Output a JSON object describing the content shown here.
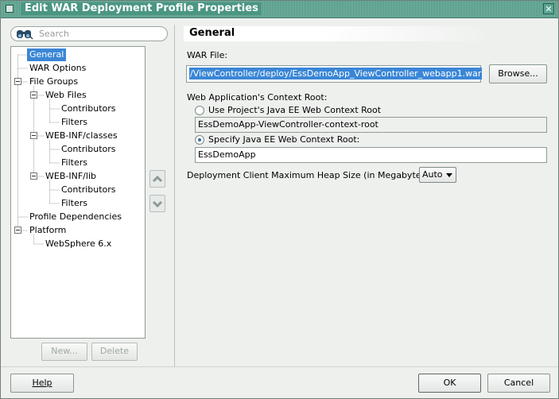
{
  "window": {
    "title": "Edit WAR Deployment Profile Properties"
  },
  "search": {
    "placeholder": "Search"
  },
  "tree": {
    "items": [
      {
        "label": "General",
        "selected": true
      },
      {
        "label": "WAR Options"
      },
      {
        "label": "File Groups"
      },
      {
        "label": "Web Files"
      },
      {
        "label": "Contributors"
      },
      {
        "label": "Filters"
      },
      {
        "label": "WEB-INF/classes"
      },
      {
        "label": "Contributors"
      },
      {
        "label": "Filters"
      },
      {
        "label": "WEB-INF/lib"
      },
      {
        "label": "Contributors"
      },
      {
        "label": "Filters"
      },
      {
        "label": "Profile Dependencies"
      },
      {
        "label": "Platform"
      },
      {
        "label": "WebSphere 6.x"
      }
    ]
  },
  "tree_buttons": {
    "new": "New...",
    "delete": "Delete"
  },
  "reorder": {
    "up_icon": "chevron-up-icon",
    "down_icon": "chevron-down-icon"
  },
  "panel": {
    "title": "General",
    "war_file_label": "WAR File:",
    "war_file_value": "/ViewController/deploy/EssDemoApp_ViewController_webapp1.war",
    "browse": "Browse...",
    "context_root_label": "Web Application's Context Root:",
    "option_project": "Use Project's Java EE Web Context Root",
    "project_root_value": "EssDemoApp-ViewController-context-root",
    "option_specify": "Specify Java EE Web Context Root:",
    "specify_value": "EssDemoApp",
    "heap_label": "Deployment Client Maximum Heap Size (in Megabytes):",
    "heap_value": "Auto"
  },
  "footer": {
    "help": "Help",
    "ok": "OK",
    "cancel": "Cancel"
  },
  "colors": {
    "titlebar": "#4a9683",
    "selection": "#3a86d6"
  }
}
